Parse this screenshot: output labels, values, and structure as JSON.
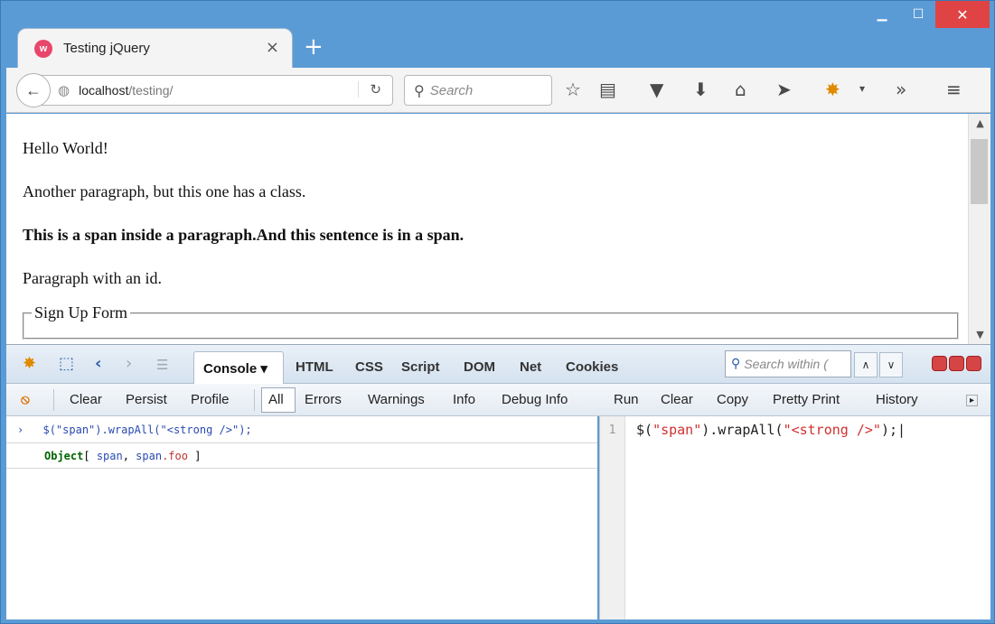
{
  "tab": {
    "title": "Testing jQuery",
    "favicon": "w"
  },
  "navbar": {
    "url_host": "localhost",
    "url_path": "/testing/",
    "search_placeholder": "Search"
  },
  "page": {
    "p1": "Hello World!",
    "p2": "Another paragraph, but this one has a class.",
    "p3": "This is a span inside a paragraph.And this sentence is in a span.",
    "p4": "Paragraph with an id.",
    "legend": "Sign Up Form"
  },
  "firebug": {
    "tabs": {
      "console": "Console ▾",
      "html": "HTML",
      "css": "CSS",
      "script": "Script",
      "dom": "DOM",
      "net": "Net",
      "cookies": "Cookies"
    },
    "search_placeholder": "Search within (",
    "toolbar": {
      "clear": "Clear",
      "persist": "Persist",
      "profile": "Profile",
      "all": "All",
      "errors": "Errors",
      "warnings": "Warnings",
      "info": "Info",
      "debug_info": "Debug Info",
      "run": "Run",
      "clear2": "Clear",
      "copy": "Copy",
      "pretty_print": "Pretty Print",
      "history": "History"
    },
    "console": {
      "command": "$(\"span\").wrapAll(\"<strong />\");",
      "result_type": "Object",
      "result_open": "[ ",
      "result_item1": "span",
      "result_sep": ", ",
      "result_item2_tag": "span",
      "result_item2_class": ".foo",
      "result_close": " ]"
    },
    "editor": {
      "line_number": "1",
      "code_prefix": "$(",
      "code_str1": "\"span\"",
      "code_mid": ").wrapAll(",
      "code_str2": "\"<strong />\"",
      "code_suffix": ");"
    }
  }
}
